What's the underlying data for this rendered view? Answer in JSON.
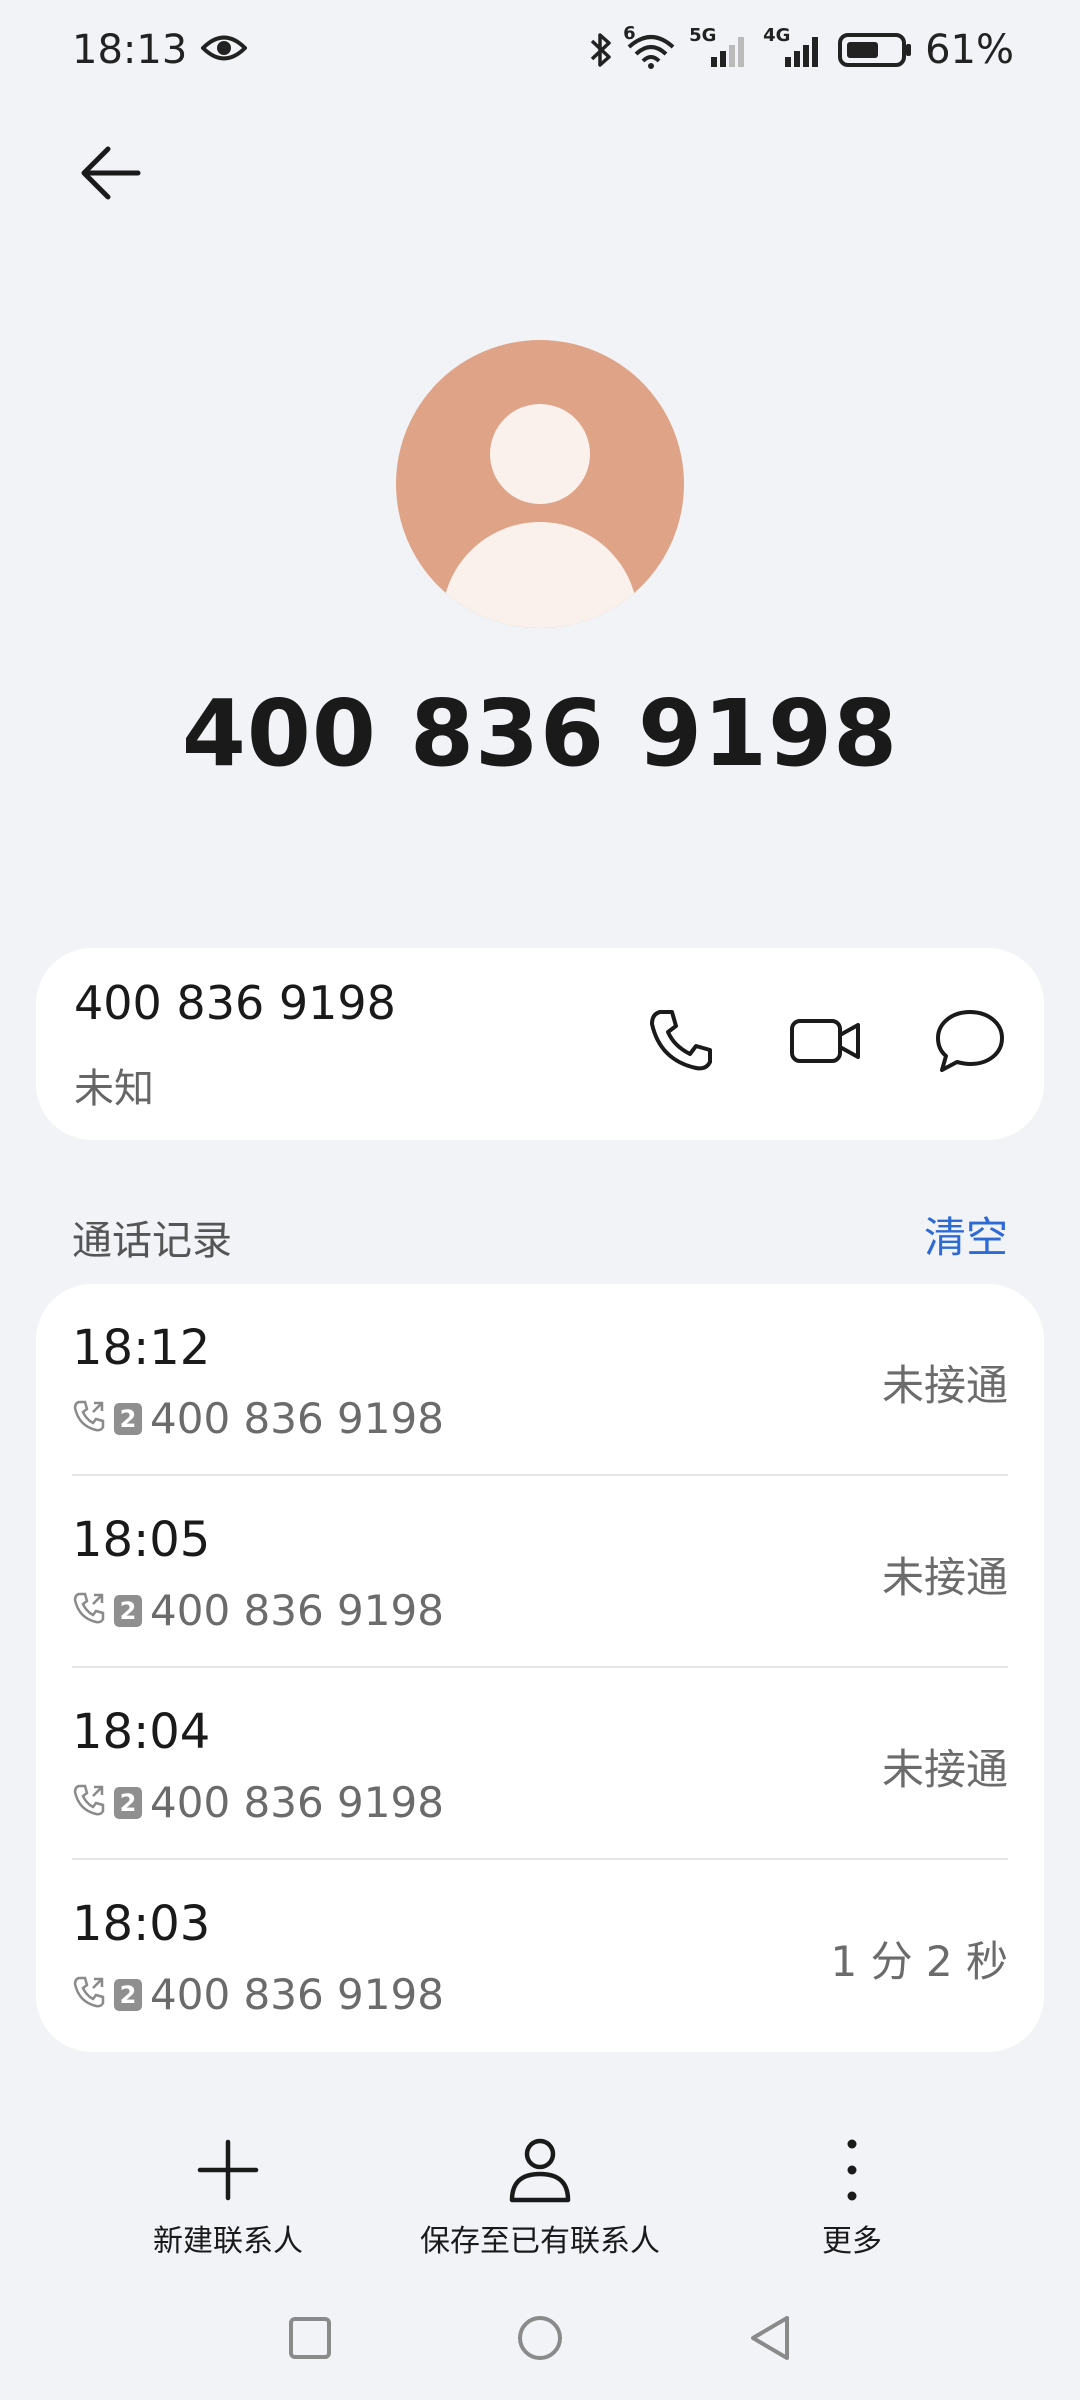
{
  "status_bar": {
    "time": "18:13",
    "icons": [
      "eye-icon",
      "bluetooth-icon",
      "wifi-icon",
      "signal-5g-icon",
      "signal-4g-icon",
      "battery-icon"
    ],
    "network_1": "5G",
    "network_2": "4G",
    "wifi_badge": "6",
    "battery": "61%",
    "battery_level": 0.61
  },
  "header": {
    "back_icon": "arrow-left-icon"
  },
  "profile": {
    "avatar_color": "#dfa487",
    "number": "400 836 9198"
  },
  "contact_card": {
    "number": "400 836 9198",
    "label": "未知",
    "actions": [
      "phone-icon",
      "video-call-icon",
      "message-icon"
    ]
  },
  "call_log": {
    "title": "通话记录",
    "clear_label": "清空",
    "accent": "#2d6ad6",
    "entries": [
      {
        "time": "18:12",
        "sim": "2",
        "number": "400 836 9198",
        "status": "未接通"
      },
      {
        "time": "18:05",
        "sim": "2",
        "number": "400 836 9198",
        "status": "未接通"
      },
      {
        "time": "18:04",
        "sim": "2",
        "number": "400 836 9198",
        "status": "未接通"
      },
      {
        "time": "18:03",
        "sim": "2",
        "number": "400 836 9198",
        "status": "1 分 2 秒"
      }
    ]
  },
  "bottom_actions": [
    {
      "label": "新建联系人",
      "icon": "plus-icon"
    },
    {
      "label": "保存至已有联系人",
      "icon": "person-icon"
    },
    {
      "label": "更多",
      "icon": "more-vertical-icon"
    }
  ],
  "nav_bar": {
    "icons": [
      "recents-square-icon",
      "home-circle-icon",
      "back-triangle-icon"
    ]
  }
}
